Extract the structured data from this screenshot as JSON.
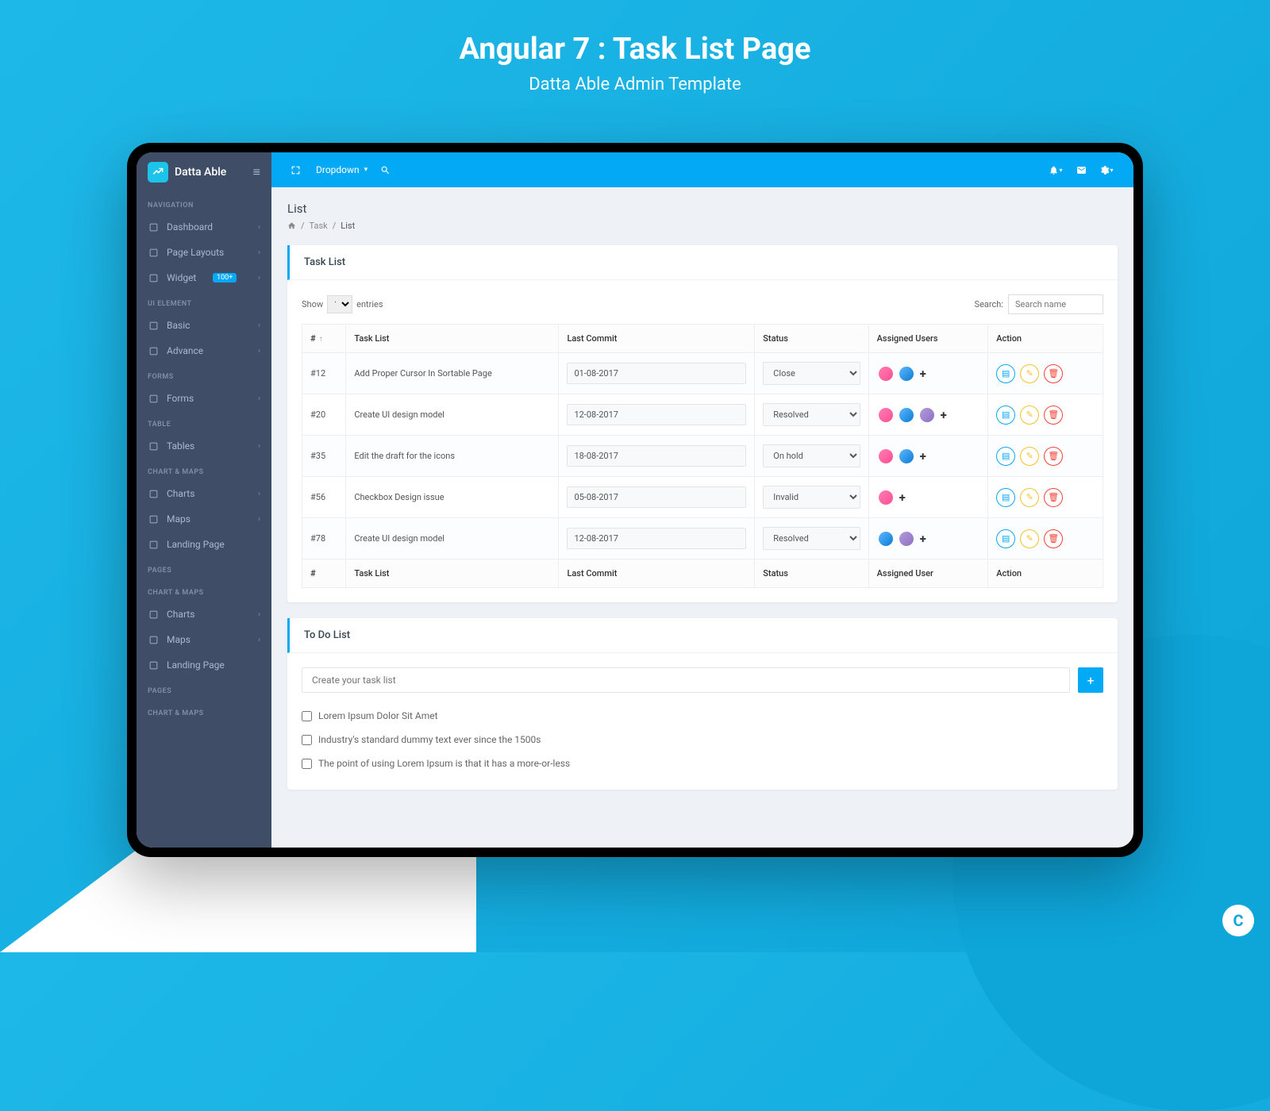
{
  "hero": {
    "title": "Angular 7 : Task List Page",
    "subtitle": "Datta Able Admin Template"
  },
  "brand": {
    "name": "Datta Able"
  },
  "sidebar": {
    "sections": [
      {
        "header": "NAVIGATION",
        "items": [
          {
            "label": "Dashboard",
            "icon": "home",
            "chevron": true
          },
          {
            "label": "Page Layouts",
            "icon": "layout",
            "chevron": true
          },
          {
            "label": "Widget",
            "icon": "widget",
            "badge": "100+",
            "chevron": true
          }
        ]
      },
      {
        "header": "UI ELEMENT",
        "items": [
          {
            "label": "Basic",
            "icon": "box",
            "chevron": true
          },
          {
            "label": "Advance",
            "icon": "advance",
            "chevron": true
          }
        ]
      },
      {
        "header": "FORMS",
        "items": [
          {
            "label": "Forms",
            "icon": "file",
            "chevron": true
          }
        ]
      },
      {
        "header": "TABLE",
        "items": [
          {
            "label": "Tables",
            "icon": "table",
            "chevron": true
          }
        ]
      },
      {
        "header": "CHART & MAPS",
        "items": [
          {
            "label": "Charts",
            "icon": "clock",
            "chevron": true
          },
          {
            "label": "Maps",
            "icon": "map",
            "chevron": true
          },
          {
            "label": "Landing Page",
            "icon": "landing",
            "chevron": false
          }
        ]
      },
      {
        "header": "PAGES",
        "items": []
      },
      {
        "header": "CHART & MAPS",
        "items": [
          {
            "label": "Charts",
            "icon": "clock",
            "chevron": true
          },
          {
            "label": "Maps",
            "icon": "map",
            "chevron": true
          },
          {
            "label": "Landing Page",
            "icon": "landing",
            "chevron": false
          }
        ]
      },
      {
        "header": "PAGES",
        "items": []
      },
      {
        "header": "CHART & MAPS",
        "items": []
      }
    ]
  },
  "topbar": {
    "dropdown_label": "Dropdown"
  },
  "page": {
    "title": "List",
    "breadcrumb": [
      "Task",
      "List"
    ]
  },
  "task_card": {
    "title": "Task List",
    "show_label": "Show",
    "entries_label": "entries",
    "entries_value": "10",
    "search_label": "Search:",
    "search_placeholder": "Search name",
    "columns": [
      "#",
      "Task List",
      "Last Commit",
      "Status",
      "Assigned Users",
      "Action"
    ],
    "footer_columns": [
      "#",
      "Task List",
      "Last Commit",
      "Status",
      "Assigned User",
      "Action"
    ],
    "rows": [
      {
        "id": "#12",
        "task": "Add Proper Cursor In Sortable Page",
        "date": "01-08-2017",
        "status": "Close",
        "avatars": [
          "av1",
          "av2"
        ]
      },
      {
        "id": "#20",
        "task": "Create UI design model",
        "date": "12-08-2017",
        "status": "Resolved",
        "avatars": [
          "av1",
          "av2",
          "av3"
        ]
      },
      {
        "id": "#35",
        "task": "Edit the draft for the icons",
        "date": "18-08-2017",
        "status": "On hold",
        "avatars": [
          "av1",
          "av2"
        ]
      },
      {
        "id": "#56",
        "task": "Checkbox Design issue",
        "date": "05-08-2017",
        "status": "Invalid",
        "avatars": [
          "av1"
        ]
      },
      {
        "id": "#78",
        "task": "Create UI design model",
        "date": "12-08-2017",
        "status": "Resolved",
        "avatars": [
          "av2",
          "av3"
        ]
      }
    ]
  },
  "todo_card": {
    "title": "To Do List",
    "input_placeholder": "Create your task list",
    "items": [
      "Lorem Ipsum Dolor Sit Amet",
      "Industry's standard dummy text ever since the 1500s",
      "The point of using Lorem Ipsum is that it has a more-or-less"
    ]
  }
}
